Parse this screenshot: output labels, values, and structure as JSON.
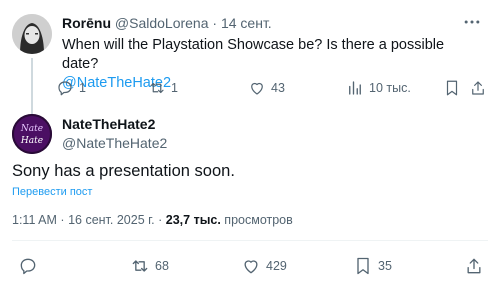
{
  "reply": {
    "display_name": "Rorēnu",
    "handle": "@SaldoLorena",
    "separator": "·",
    "date": "14 сент.",
    "text": "When will the Playstation Showcase be? Is there a possible date?",
    "mention": "@NateTheHate2",
    "stats": {
      "replies": "1",
      "reposts": "1",
      "likes": "43",
      "views": "10 тыс."
    }
  },
  "tweet": {
    "display_name": "NateTheHate2",
    "handle": "@NateTheHate2",
    "avatar_text": "NATE THE HATE",
    "text": "Sony has a presentation soon.",
    "translate_label": "Перевести пост",
    "time": "1:11 AM",
    "separator": "·",
    "date": "16 сент. 2025 г.",
    "views_count": "23,7 тыс.",
    "views_label": "просмотров",
    "stats": {
      "reposts": "68",
      "likes": "429",
      "bookmarks": "35"
    }
  },
  "colors": {
    "accent": "#1d9bf0",
    "text_secondary": "#536471",
    "divider": "#eff3f4"
  },
  "icons": [
    "more-icon",
    "reply-icon",
    "repost-icon",
    "like-icon",
    "views-icon",
    "bookmark-icon",
    "share-icon"
  ]
}
